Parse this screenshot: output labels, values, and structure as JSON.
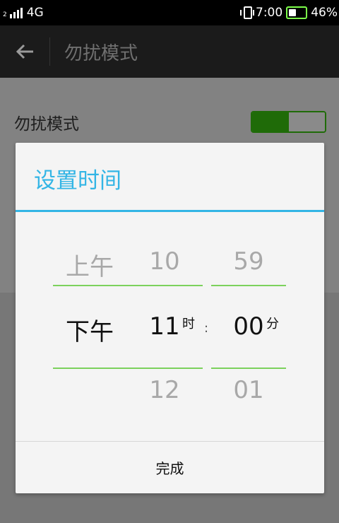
{
  "status_bar": {
    "sim_slot": "2",
    "network": "4G",
    "time": "7:00",
    "battery_percent": "46%",
    "battery_level": 0.46,
    "battery_color": "#7dff4a"
  },
  "action_bar": {
    "back_icon": "arrow-left-icon",
    "title": "勿扰模式"
  },
  "settings": {
    "do_not_disturb_label": "勿扰模式",
    "do_not_disturb_enabled": true
  },
  "dialog": {
    "title": "设置时间",
    "accent_color": "#33b5e5",
    "ampm": {
      "prev": "上午",
      "current": "下午"
    },
    "hour": {
      "prev": "10",
      "current": "11",
      "next": "12",
      "unit": "时"
    },
    "separator": ":",
    "minute": {
      "prev": "59",
      "current": "00",
      "next": "01",
      "unit": "分"
    },
    "done_label": "完成"
  }
}
